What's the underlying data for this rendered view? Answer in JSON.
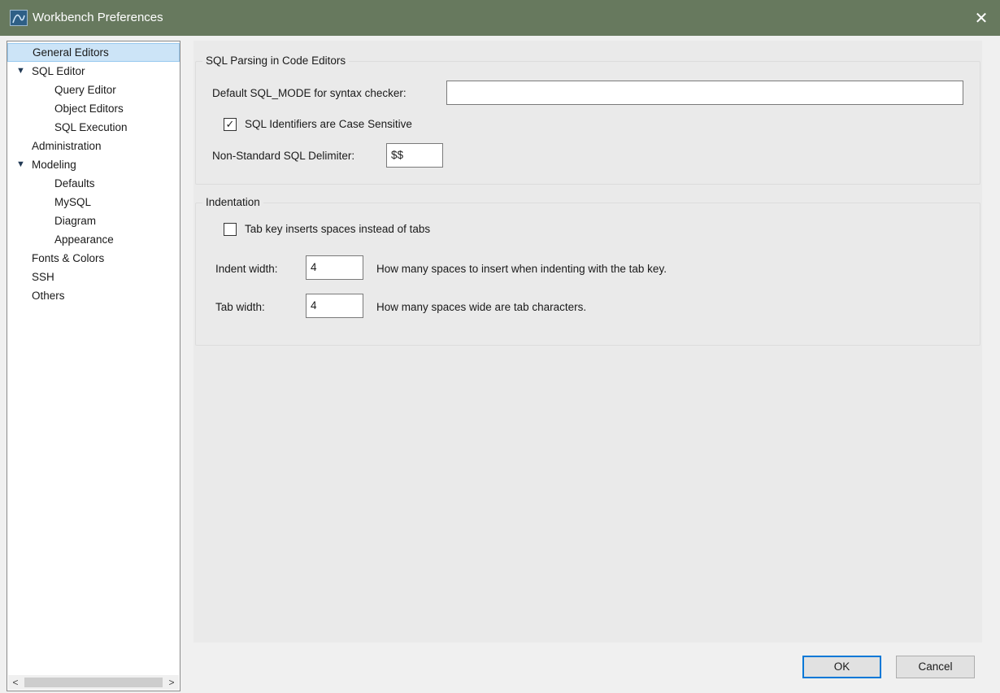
{
  "window": {
    "title": "Workbench Preferences",
    "close_glyph": "✕"
  },
  "sidebar": {
    "items": [
      {
        "label": "General Editors",
        "level": 0,
        "selected": true
      },
      {
        "label": "SQL Editor",
        "level": 0,
        "expanded": true,
        "arrow": "▼"
      },
      {
        "label": "Query Editor",
        "level": 1
      },
      {
        "label": "Object Editors",
        "level": 1
      },
      {
        "label": "SQL Execution",
        "level": 1
      },
      {
        "label": "Administration",
        "level": 0
      },
      {
        "label": "Modeling",
        "level": 0,
        "expanded": true,
        "arrow": "▼"
      },
      {
        "label": "Defaults",
        "level": 1
      },
      {
        "label": "MySQL",
        "level": 1
      },
      {
        "label": "Diagram",
        "level": 1
      },
      {
        "label": "Appearance",
        "level": 1
      },
      {
        "label": "Fonts & Colors",
        "level": 0
      },
      {
        "label": "SSH",
        "level": 0
      },
      {
        "label": "Others",
        "level": 0
      }
    ],
    "scroll_left": "<",
    "scroll_right": ">"
  },
  "sql_parsing": {
    "legend": "SQL Parsing in Code Editors",
    "sql_mode_label": "Default SQL_MODE for syntax checker:",
    "sql_mode_value": "",
    "case_sensitive_label": "SQL Identifiers are Case Sensitive",
    "case_sensitive_checked": true,
    "check_glyph": "✓",
    "delimiter_label": "Non-Standard SQL Delimiter:",
    "delimiter_value": "$$"
  },
  "indentation": {
    "legend": "Indentation",
    "tab_spaces_label": "Tab key inserts spaces instead of tabs",
    "tab_spaces_checked": false,
    "indent_width_label": "Indent width:",
    "indent_width_value": "4",
    "indent_width_help": "How many spaces to insert when indenting with the tab key.",
    "tab_width_label": "Tab width:",
    "tab_width_value": "4",
    "tab_width_help": "How many spaces wide are tab characters."
  },
  "buttons": {
    "ok": "OK",
    "cancel": "Cancel"
  },
  "colors": {
    "titlebar": "#67795e",
    "selection": "#cce4f7",
    "default_button_border": "#0078d7"
  }
}
